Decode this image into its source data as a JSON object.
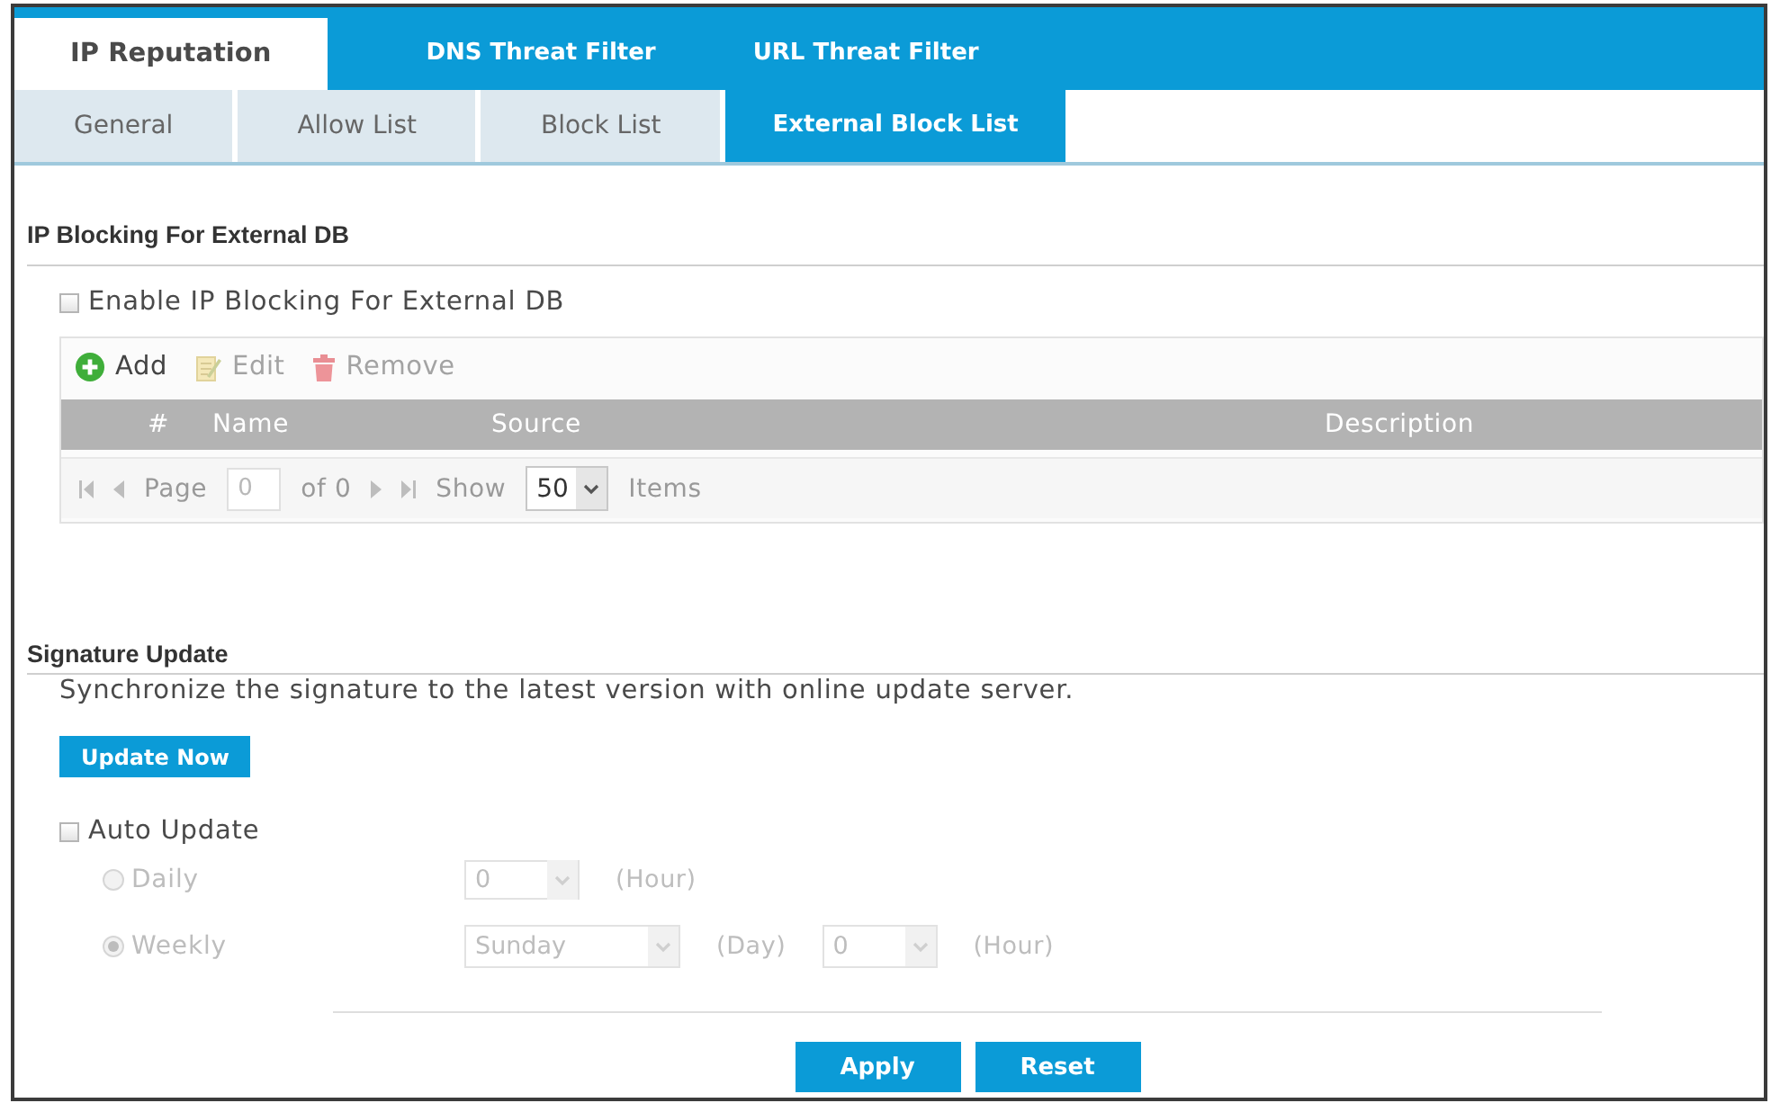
{
  "tabs": [
    {
      "label": "IP Reputation",
      "selected": true
    },
    {
      "label": "DNS Threat Filter",
      "selected": false
    },
    {
      "label": "URL Threat Filter",
      "selected": false
    }
  ],
  "subtabs": [
    {
      "label": "General",
      "selected": false
    },
    {
      "label": "Allow List",
      "selected": false
    },
    {
      "label": "Block List",
      "selected": false
    },
    {
      "label": "External Block List",
      "selected": true
    }
  ],
  "ip_blocking": {
    "title": "IP Blocking For External DB",
    "enable": {
      "label": "Enable IP Blocking For External DB",
      "checked": false
    },
    "toolbar": [
      {
        "kind": "add",
        "label": "Add",
        "disabled": false
      },
      {
        "kind": "edit",
        "label": "Edit",
        "disabled": true
      },
      {
        "kind": "remove",
        "label": "Remove",
        "disabled": true
      }
    ],
    "columns": [
      "#",
      "Name",
      "Source",
      "Description"
    ],
    "pager": {
      "page_label": "Page",
      "page": "0",
      "total": "of 0",
      "show_label": "Show",
      "page_size": "50",
      "items_label": "Items"
    }
  },
  "signature_update": {
    "title": "Signature Update",
    "description": "Synchronize the signature to the latest version with online update server.",
    "update_button": "Update Now",
    "auto_update": {
      "label": "Auto Update",
      "checked": false
    },
    "schedule": [
      {
        "label": "Daily",
        "selected": false,
        "disabled": true,
        "fields": [
          {
            "kind": "select",
            "value": "0"
          },
          {
            "kind": "unit",
            "text": "(Hour)"
          }
        ]
      },
      {
        "label": "Weekly",
        "selected": true,
        "disabled": true,
        "fields": [
          {
            "kind": "select",
            "value": "Sunday"
          },
          {
            "kind": "unit",
            "text": "(Day)"
          },
          {
            "kind": "select",
            "value": "0"
          },
          {
            "kind": "unit",
            "text": "(Hour)"
          }
        ]
      }
    ]
  },
  "buttons": [
    "Apply",
    "Reset"
  ]
}
